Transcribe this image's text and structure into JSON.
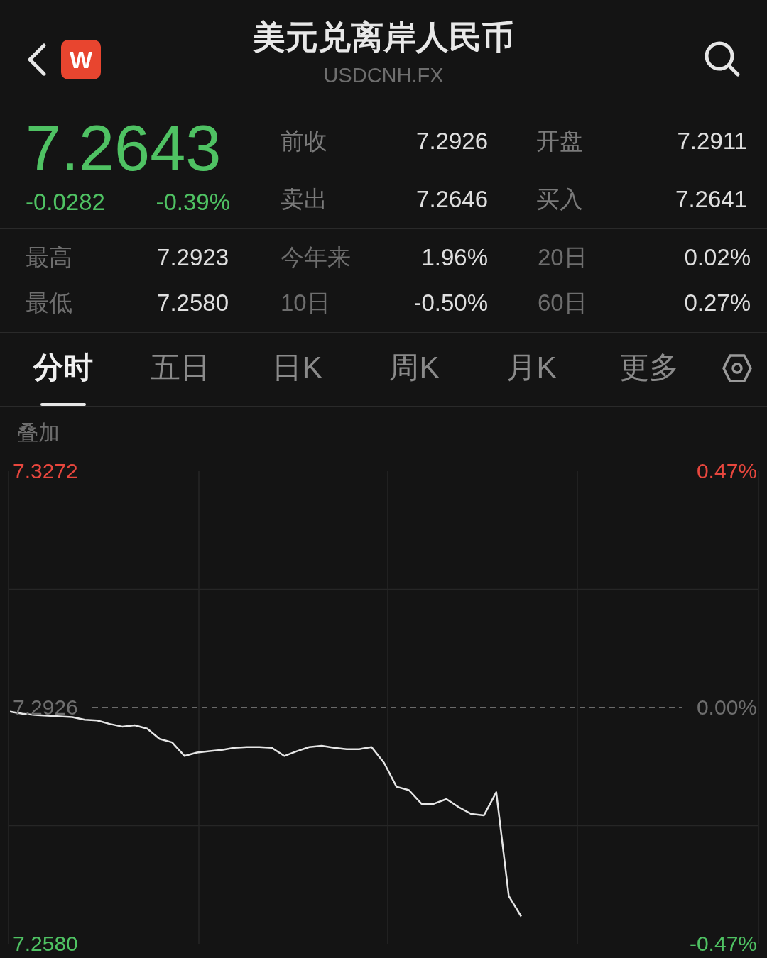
{
  "header": {
    "logo_text": "W",
    "title": "美元兑离岸人民币",
    "symbol": "USDCNH.FX"
  },
  "quote": {
    "price": "7.2643",
    "change": "-0.0282",
    "change_pct": "-0.39%",
    "fields": [
      {
        "label": "前收",
        "value": "7.2926"
      },
      {
        "label": "开盘",
        "value": "7.2911"
      },
      {
        "label": "卖出",
        "value": "7.2646"
      },
      {
        "label": "买入",
        "value": "7.2641"
      }
    ]
  },
  "stats": [
    {
      "label": "最高",
      "value": "7.2923"
    },
    {
      "label": "今年来",
      "value": "1.96%"
    },
    {
      "label": "20日",
      "value": "0.02%"
    },
    {
      "label": "最低",
      "value": "7.2580"
    },
    {
      "label": "10日",
      "value": "-0.50%"
    },
    {
      "label": "60日",
      "value": "0.27%"
    }
  ],
  "tabs": [
    {
      "label": "分时",
      "selected": true
    },
    {
      "label": "五日",
      "selected": false
    },
    {
      "label": "日K",
      "selected": false
    },
    {
      "label": "周K",
      "selected": false
    },
    {
      "label": "月K",
      "selected": false
    },
    {
      "label": "更多",
      "selected": false
    }
  ],
  "overlay_label": "叠加",
  "chart": {
    "percent_labels": [
      {
        "label": "0.47%",
        "color": "#e8473e"
      },
      {
        "label": "0.00%",
        "color": "#6e6e6e"
      },
      {
        "label": "-0.47%",
        "color": "#4fc263"
      }
    ],
    "chart_data": {
      "type": "line",
      "ylim": [
        7.258,
        7.3272
      ],
      "yticks": [
        {
          "value": 7.258,
          "label": "7.2580"
        },
        {
          "value": 7.2926,
          "label": "7.2926"
        },
        {
          "value": 7.3272,
          "label": "7.3272"
        }
      ],
      "series": [
        {
          "color": "#e6e6e6",
          "values": [
            7.292,
            7.2917,
            7.2915,
            7.2914,
            7.2913,
            7.2912,
            7.2908,
            7.2907,
            7.2902,
            7.2898,
            7.29,
            7.2895,
            7.288,
            7.2875,
            7.2855,
            7.286,
            7.2862,
            7.2864,
            7.2867,
            7.2868,
            7.2868,
            7.2867,
            7.2855,
            7.2862,
            7.2868,
            7.287,
            7.2867,
            7.2865,
            7.2865,
            7.2868,
            7.2845,
            7.281,
            7.2805,
            7.2785,
            7.2785,
            7.2792,
            7.278,
            7.277,
            7.2768,
            7.2802,
            7.265,
            7.262,
            null,
            null,
            null,
            null,
            null,
            null,
            null,
            null,
            null,
            null,
            null,
            null,
            null,
            null,
            null,
            null,
            null,
            null
          ]
        }
      ]
    }
  }
}
